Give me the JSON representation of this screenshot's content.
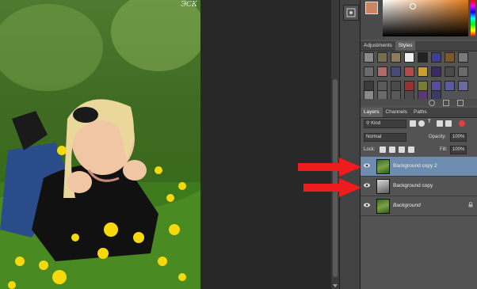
{
  "canvas": {
    "watermark": "ЭСК"
  },
  "styles_panel": {
    "tabs": [
      {
        "label": "Adjustments",
        "active": false
      },
      {
        "label": "Styles",
        "active": true
      }
    ],
    "swatch_colors": [
      "#8a8a8a",
      "#7a6a52",
      "#8c7a5c",
      "#f0f0f0",
      "#222222",
      "#3c3c9a",
      "#7a5a2a",
      "#7a7a7a",
      "#6a6a6a",
      "#b56a6a",
      "#4a4a7a",
      "#b54a4a",
      "#c8a030",
      "#3a2a6a",
      "#4a4a4a",
      "#6a6a6a",
      "#3a3a3a",
      "#5a5a5a",
      "#4a4a4a",
      "#9a3030",
      "#7a7a3a",
      "#5a4aa0",
      "#5a5aa0",
      "#6a6aa0",
      "#8a8a8a",
      "#6a6a6a",
      "#5a5a5a",
      "#4a4a4a",
      "#5a3a6a",
      "#3a3a6a"
    ]
  },
  "layers_panel": {
    "tabs": [
      {
        "label": "Layers",
        "active": true
      },
      {
        "label": "Channels",
        "active": false
      },
      {
        "label": "Paths",
        "active": false
      }
    ],
    "filter_kind": "Kind",
    "blend_mode": "Normal",
    "opacity_label": "Opacity:",
    "opacity_value": "100%",
    "lock_label": "Lock:",
    "fill_label": "Fill:",
    "fill_value": "100%",
    "layers": [
      {
        "name": "Background copy 2",
        "selected": true
      },
      {
        "name": "Background copy",
        "selected": false
      },
      {
        "name": "Background",
        "selected": false,
        "italic": true
      }
    ]
  },
  "annotations": {
    "arrow_color": "#ee1c1c"
  }
}
